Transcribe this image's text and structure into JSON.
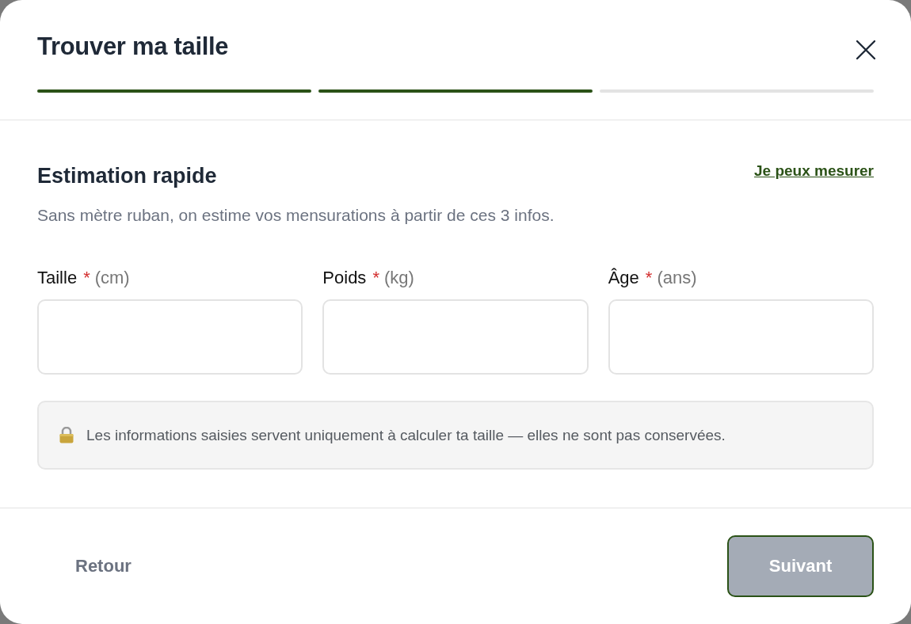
{
  "dialog": {
    "title": "Trouver ma taille"
  },
  "progress": {
    "steps": [
      {
        "completed": true
      },
      {
        "completed": true
      },
      {
        "completed": false
      }
    ]
  },
  "section": {
    "title": "Estimation rapide",
    "link": "Je peux mesurer",
    "description": "Sans mètre ruban, on estime vos mensurations à partir de ces 3 infos."
  },
  "fields": [
    {
      "label": "Taille",
      "asterisk": "*",
      "unit": "(cm)"
    },
    {
      "label": "Poids",
      "asterisk": "*",
      "unit": "(kg)"
    },
    {
      "label": "Âge",
      "asterisk": "*",
      "unit": "(ans)"
    }
  ],
  "notice": {
    "text": "Les informations saisies servent uniquement à calculer ta taille — elles ne sont pas conservées."
  },
  "footer": {
    "back_button": {
      "label": "Retour"
    },
    "next_button": {
      "label": "Suivant",
      "disabled": true
    }
  }
}
